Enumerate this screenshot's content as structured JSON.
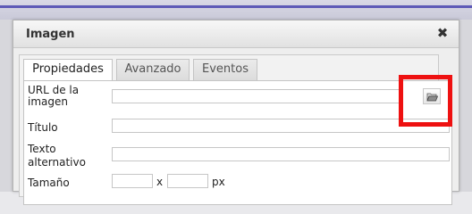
{
  "dialog": {
    "title": "Imagen",
    "close_glyph": "✖"
  },
  "tabs": [
    {
      "label": "Propiedades",
      "active": true
    },
    {
      "label": "Avanzado",
      "active": false
    },
    {
      "label": "Eventos",
      "active": false
    }
  ],
  "fields": {
    "url": {
      "label_line1": "URL de la",
      "label_line2": "imagen",
      "value": ""
    },
    "title": {
      "label": "Título",
      "value": ""
    },
    "alt": {
      "label_line1": "Texto",
      "label_line2": "alternativo",
      "value": ""
    },
    "size": {
      "label": "Tamaño",
      "width": "",
      "height": "",
      "separator": "x",
      "unit": "px"
    }
  },
  "icons": {
    "browse": "folder-open-icon",
    "close": "close-icon"
  },
  "colors": {
    "highlight": "#ee1111",
    "top_line": "#5e5ab7"
  }
}
